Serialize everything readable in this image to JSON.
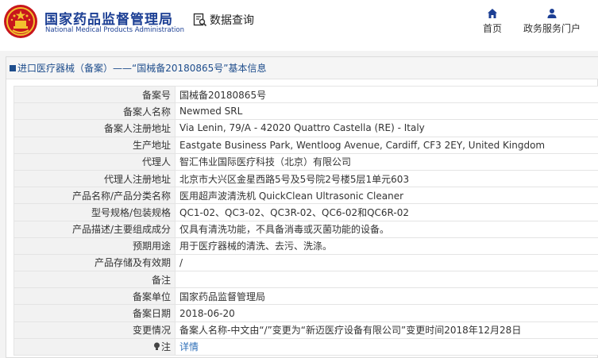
{
  "header": {
    "org_name_cn": "国家药品监督管理局",
    "org_name_en": "National Medical Products Administration",
    "query_label": "数据查询",
    "nav": [
      {
        "label": "首页",
        "icon": "home-icon"
      },
      {
        "label": "政务服务门户",
        "icon": "user-icon"
      }
    ]
  },
  "panel": {
    "title": "进口医疗器械（备案）——“国械备20180865号”基本信息"
  },
  "rows": [
    {
      "label": "备案号",
      "value": "国械备20180865号"
    },
    {
      "label": "备案人名称",
      "value": "Newmed SRL"
    },
    {
      "label": "备案人注册地址",
      "value": "Via Lenin, 79/A - 42020 Quattro Castella (RE) - Italy"
    },
    {
      "label": "生产地址",
      "value": "Eastgate Business Park, Wentloog Avenue, Cardiff, CF3 2EY, United Kingdom"
    },
    {
      "label": "代理人",
      "value": "智汇伟业国际医疗科技（北京）有限公司"
    },
    {
      "label": "代理人注册地址",
      "value": "北京市大兴区金星西路5号及5号院2号楼5层1单元603"
    },
    {
      "label": "产品名称/产品分类名称",
      "value": "医用超声波清洗机 QuickClean Ultrasonic Cleaner"
    },
    {
      "label": "型号规格/包装规格",
      "value": "QC1-02、QC3-02、QC3R-02、QC6-02和QC6R-02"
    },
    {
      "label": "产品描述/主要组成成分",
      "value": "仅具有清洗功能，不具备消毒或灭菌功能的设备。"
    },
    {
      "label": "预期用途",
      "value": "用于医疗器械的清洗、去污、洗涤。"
    },
    {
      "label": "产品存储及有效期",
      "value": "/"
    },
    {
      "label": "备注",
      "value": ""
    },
    {
      "label": "备案单位",
      "value": "国家药品监督管理局"
    },
    {
      "label": "备案日期",
      "value": "2018-06-20"
    },
    {
      "label": "变更情况",
      "value": "备案人名称-中文由“/”变更为“新迈医疗设备有限公司”变更时间2018年12月28日"
    }
  ],
  "note_row": {
    "label": "注",
    "icon": "lightbulb-icon",
    "link_text": "详情"
  },
  "colors": {
    "brand_blue": "#1c3f94",
    "link_blue": "#2e6fb8",
    "emblem_red": "#c8161d",
    "emblem_gold": "#f2c12e"
  }
}
